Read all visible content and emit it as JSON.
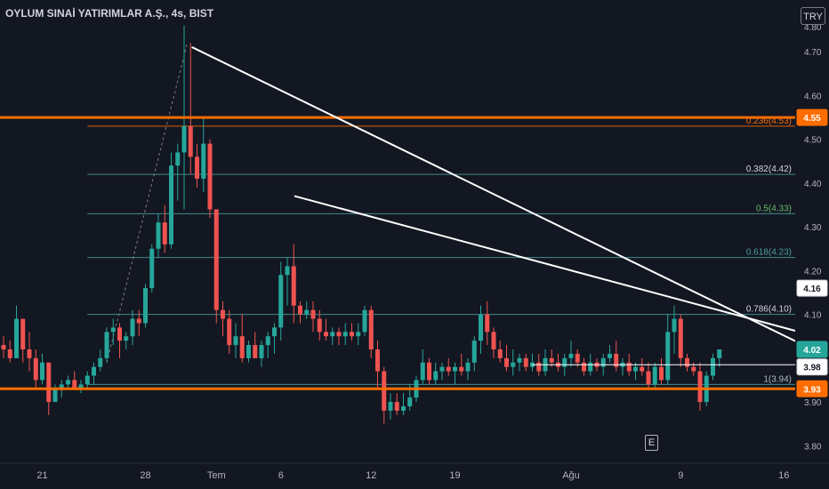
{
  "header": {
    "title": "OYLUM SINAİ YATIRIMLAR A.Ş., 4s, BIST",
    "currency_button": "TRY",
    "event_marker": "E"
  },
  "colors": {
    "background": "#131722",
    "up": "#26a69a",
    "down": "#ef5350",
    "orange": "#ff6d00",
    "fib": "#4a9e9c",
    "trendline": "#ffffff",
    "text": "#d1d4dc"
  },
  "chart_data": {
    "type": "candlestick",
    "ylim": [
      3.76,
      4.8
    ],
    "y_ticks": [
      {
        "value": 4.7,
        "label": "4.70"
      },
      {
        "value": 4.6,
        "label": "4.60"
      },
      {
        "value": 4.5,
        "label": "4.50"
      },
      {
        "value": 4.4,
        "label": "4.40"
      },
      {
        "value": 4.3,
        "label": "4.30"
      },
      {
        "value": 4.2,
        "label": "4.20"
      },
      {
        "value": 4.1,
        "label": "4.10"
      },
      {
        "value": 3.9,
        "label": "3.90"
      },
      {
        "value": 3.8,
        "label": "3.80"
      }
    ],
    "x_ticks": [
      {
        "index": 6,
        "label": "21"
      },
      {
        "index": 22,
        "label": "28"
      },
      {
        "index": 33,
        "label": "Tem"
      },
      {
        "index": 43,
        "label": "6"
      },
      {
        "index": 57,
        "label": "12"
      },
      {
        "index": 70,
        "label": "19"
      },
      {
        "index": 88,
        "label": "Ağu"
      },
      {
        "index": 105,
        "label": "9"
      },
      {
        "index": 121,
        "label": "16"
      }
    ],
    "candles": [
      [
        4.03,
        4.05,
        4.0,
        4.02
      ],
      [
        4.02,
        4.04,
        3.99,
        4.0
      ],
      [
        4.0,
        4.12,
        4.0,
        4.09
      ],
      [
        4.09,
        4.09,
        3.99,
        4.02
      ],
      [
        4.02,
        4.06,
        3.97,
        4.0
      ],
      [
        4.0,
        4.02,
        3.93,
        3.95
      ],
      [
        3.95,
        4.01,
        3.94,
        3.99
      ],
      [
        3.99,
        3.99,
        3.87,
        3.9
      ],
      [
        3.9,
        3.94,
        3.9,
        3.93
      ],
      [
        3.93,
        3.95,
        3.91,
        3.94
      ],
      [
        3.94,
        3.96,
        3.93,
        3.95
      ],
      [
        3.95,
        3.97,
        3.93,
        3.93
      ],
      [
        3.93,
        3.95,
        3.92,
        3.94
      ],
      [
        3.94,
        3.97,
        3.93,
        3.96
      ],
      [
        3.96,
        3.99,
        3.94,
        3.98
      ],
      [
        3.98,
        4.02,
        3.97,
        4.0
      ],
      [
        4.0,
        4.07,
        3.99,
        4.06
      ],
      [
        4.06,
        4.09,
        4.03,
        4.07
      ],
      [
        4.07,
        4.08,
        4.0,
        4.04
      ],
      [
        4.04,
        4.06,
        4.02,
        4.05
      ],
      [
        4.05,
        4.11,
        4.03,
        4.09
      ],
      [
        4.09,
        4.11,
        4.05,
        4.08
      ],
      [
        4.08,
        4.17,
        4.07,
        4.16
      ],
      [
        4.16,
        4.26,
        4.15,
        4.25
      ],
      [
        4.25,
        4.33,
        4.23,
        4.31
      ],
      [
        4.31,
        4.35,
        4.24,
        4.26
      ],
      [
        4.26,
        4.47,
        4.25,
        4.44
      ],
      [
        4.44,
        4.49,
        4.36,
        4.47
      ],
      [
        4.47,
        4.76,
        4.34,
        4.53
      ],
      [
        4.53,
        4.72,
        4.42,
        4.46
      ],
      [
        4.46,
        4.49,
        4.39,
        4.41
      ],
      [
        4.41,
        4.55,
        4.38,
        4.49
      ],
      [
        4.49,
        4.5,
        4.32,
        4.34
      ],
      [
        4.34,
        4.34,
        4.08,
        4.11
      ],
      [
        4.11,
        4.13,
        4.05,
        4.09
      ],
      [
        4.09,
        4.11,
        4.01,
        4.03
      ],
      [
        4.03,
        4.08,
        4.0,
        4.05
      ],
      [
        4.05,
        4.1,
        3.99,
        4.0
      ],
      [
        4.0,
        4.04,
        3.99,
        4.03
      ],
      [
        4.03,
        4.06,
        4.0,
        4.0
      ],
      [
        4.0,
        4.04,
        3.98,
        4.03
      ],
      [
        4.03,
        4.06,
        4.0,
        4.05
      ],
      [
        4.05,
        4.08,
        4.01,
        4.07
      ],
      [
        4.07,
        4.22,
        4.04,
        4.19
      ],
      [
        4.19,
        4.23,
        4.12,
        4.21
      ],
      [
        4.21,
        4.26,
        4.08,
        4.12
      ],
      [
        4.12,
        4.13,
        4.08,
        4.1
      ],
      [
        4.1,
        4.13,
        4.09,
        4.11
      ],
      [
        4.11,
        4.13,
        4.06,
        4.09
      ],
      [
        4.09,
        4.11,
        4.04,
        4.06
      ],
      [
        4.06,
        4.09,
        4.04,
        4.05
      ],
      [
        4.05,
        4.07,
        4.03,
        4.06
      ],
      [
        4.06,
        4.07,
        4.03,
        4.05
      ],
      [
        4.05,
        4.08,
        4.03,
        4.06
      ],
      [
        4.06,
        4.08,
        4.04,
        4.05
      ],
      [
        4.05,
        4.08,
        4.03,
        4.06
      ],
      [
        4.06,
        4.12,
        4.05,
        4.11
      ],
      [
        4.11,
        4.12,
        4.0,
        4.02
      ],
      [
        4.02,
        4.04,
        3.93,
        3.97
      ],
      [
        3.97,
        3.98,
        3.85,
        3.88
      ],
      [
        3.88,
        3.92,
        3.86,
        3.9
      ],
      [
        3.9,
        3.92,
        3.87,
        3.88
      ],
      [
        3.88,
        3.92,
        3.87,
        3.89
      ],
      [
        3.89,
        3.94,
        3.88,
        3.91
      ],
      [
        3.91,
        3.96,
        3.9,
        3.95
      ],
      [
        3.95,
        4.02,
        3.94,
        3.99
      ],
      [
        3.99,
        4.0,
        3.94,
        3.95
      ],
      [
        3.95,
        3.99,
        3.94,
        3.97
      ],
      [
        3.97,
        3.99,
        3.95,
        3.98
      ],
      [
        3.98,
        4.0,
        3.96,
        3.97
      ],
      [
        3.97,
        3.99,
        3.94,
        3.98
      ],
      [
        3.98,
        4.01,
        3.96,
        3.97
      ],
      [
        3.97,
        4.0,
        3.95,
        3.99
      ],
      [
        3.99,
        4.05,
        3.97,
        4.04
      ],
      [
        4.04,
        4.12,
        4.01,
        4.1
      ],
      [
        4.1,
        4.13,
        4.03,
        4.06
      ],
      [
        4.06,
        4.07,
        4.0,
        4.02
      ],
      [
        4.02,
        4.04,
        3.99,
        4.0
      ],
      [
        4.0,
        4.03,
        3.97,
        3.98
      ],
      [
        3.98,
        4.02,
        3.96,
        3.99
      ],
      [
        3.99,
        4.01,
        3.97,
        4.0
      ],
      [
        4.0,
        4.01,
        3.97,
        3.98
      ],
      [
        3.98,
        4.01,
        3.97,
        3.99
      ],
      [
        3.99,
        4.01,
        3.96,
        3.97
      ],
      [
        3.97,
        4.02,
        3.96,
        4.0
      ],
      [
        4.0,
        4.02,
        3.98,
        3.99
      ],
      [
        3.99,
        4.01,
        3.97,
        3.98
      ],
      [
        3.98,
        4.01,
        3.96,
        4.0
      ],
      [
        4.0,
        4.04,
        3.98,
        4.01
      ],
      [
        4.01,
        4.02,
        3.98,
        3.99
      ],
      [
        3.99,
        4.0,
        3.96,
        3.97
      ],
      [
        3.97,
        4.01,
        3.96,
        3.99
      ],
      [
        3.99,
        4.0,
        3.97,
        3.98
      ],
      [
        3.98,
        4.01,
        3.96,
        4.0
      ],
      [
        4.0,
        4.03,
        3.99,
        4.01
      ],
      [
        4.01,
        4.04,
        3.97,
        3.98
      ],
      [
        3.98,
        4.0,
        3.96,
        3.99
      ],
      [
        3.99,
        4.01,
        3.96,
        3.97
      ],
      [
        3.97,
        3.99,
        3.95,
        3.98
      ],
      [
        3.98,
        4.0,
        3.96,
        3.97
      ],
      [
        3.97,
        3.99,
        3.93,
        3.94
      ],
      [
        3.94,
        3.99,
        3.93,
        3.98
      ],
      [
        3.98,
        4.0,
        3.94,
        3.95
      ],
      [
        3.95,
        4.1,
        3.94,
        4.06
      ],
      [
        4.06,
        4.12,
        4.01,
        4.09
      ],
      [
        4.09,
        4.1,
        3.98,
        4.0
      ],
      [
        4.0,
        4.01,
        3.97,
        3.98
      ],
      [
        3.98,
        3.99,
        3.96,
        3.97
      ],
      [
        3.97,
        3.99,
        3.88,
        3.9
      ],
      [
        3.9,
        3.97,
        3.89,
        3.96
      ],
      [
        3.96,
        4.01,
        3.95,
        4.0
      ],
      [
        4.0,
        4.02,
        3.98,
        4.02
      ]
    ],
    "horizontal_levels": [
      {
        "value": 4.55,
        "label": "4.55",
        "color": "#ff6d00"
      },
      {
        "value": 3.93,
        "label": "3.93",
        "color": "#ff6d00"
      }
    ],
    "fib_levels": [
      {
        "value": 4.53,
        "label": "0.236(4.53)",
        "color": "#ff6d00"
      },
      {
        "value": 4.42,
        "label": "0.382(4.42)",
        "color": "#d1d4dc"
      },
      {
        "value": 4.33,
        "label": "0.5(4.33)",
        "color": "#66bb6a"
      },
      {
        "value": 4.23,
        "label": "0.618(4.23)",
        "color": "#4a9e9c"
      },
      {
        "value": 4.1,
        "label": "0.786(4.10)",
        "color": "#d1d4dc"
      },
      {
        "value": 3.94,
        "label": "1(3.94)",
        "color": "#b2b5be"
      }
    ],
    "price_tags": [
      {
        "value": 4.16,
        "label": "4.16",
        "style": "white"
      },
      {
        "value": 4.02,
        "label": "4.02",
        "style": "up"
      },
      {
        "value": 3.98,
        "label": "3.98",
        "style": "white"
      }
    ],
    "partial_top_label": "4.80",
    "trendlines": [
      {
        "from": [
          29.3,
          4.71
        ],
        "to": [
          131,
          3.98
        ]
      },
      {
        "from": [
          45.2,
          4.37
        ],
        "to": [
          131,
          4.03
        ]
      },
      {
        "from": [
          82,
          3.985
        ],
        "to": [
          131,
          3.985
        ]
      }
    ],
    "dashed_projection": {
      "from": [
        16,
        3.99
      ],
      "to": [
        28.5,
        4.72
      ]
    }
  }
}
